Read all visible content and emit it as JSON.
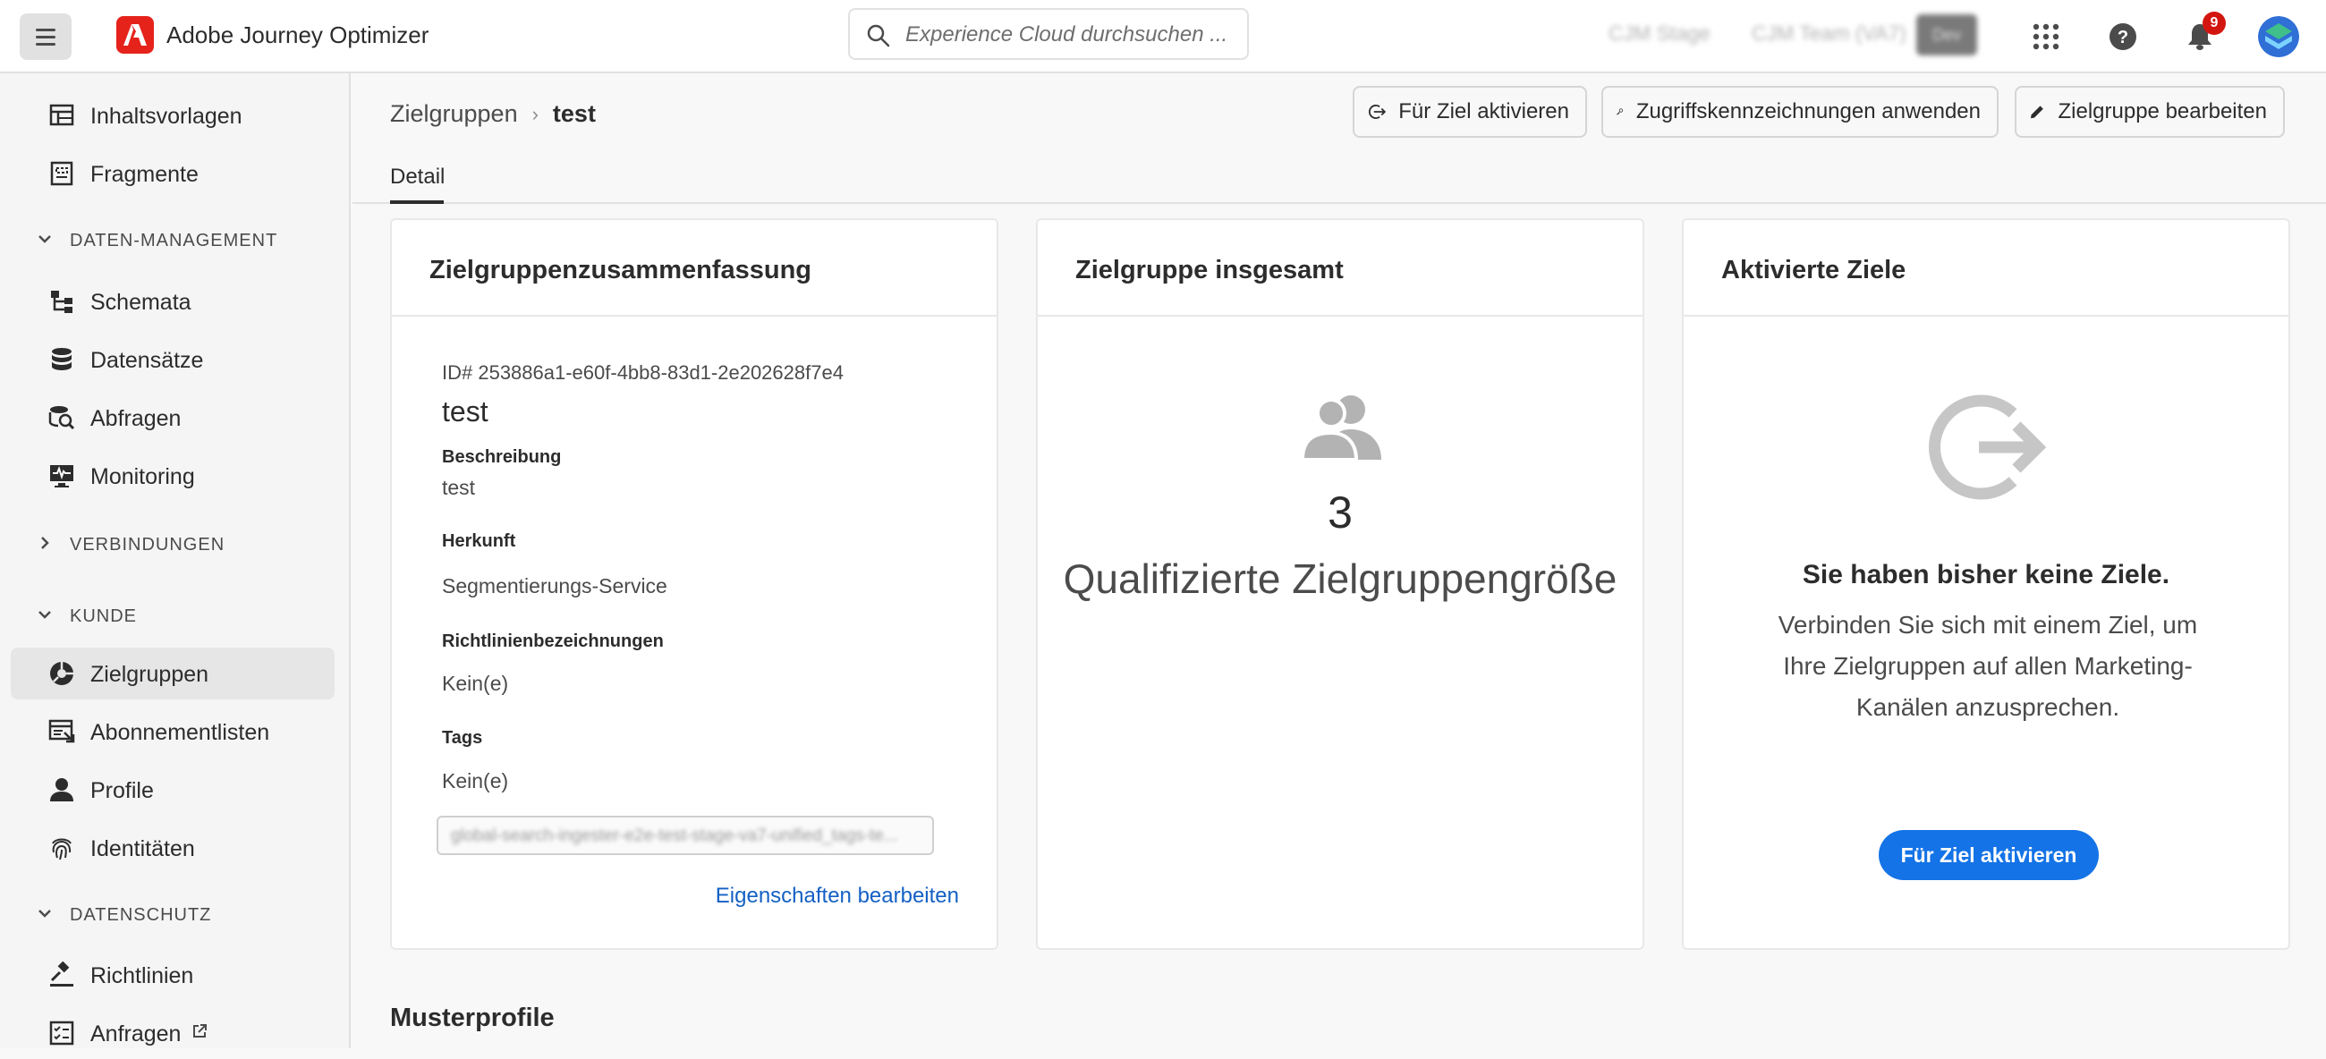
{
  "app": {
    "title": "Adobe Journey Optimizer"
  },
  "search": {
    "placeholder": "Experience Cloud durchsuchen ..."
  },
  "topbar": {
    "org1": "CJM Stage",
    "org2": "CJM Team (VA7)",
    "env_badge": "Dev",
    "notifications_count": "9"
  },
  "sidebar": {
    "items_top": [
      {
        "label": "Inhaltsvorlagen",
        "icon": "template-icon"
      },
      {
        "label": "Fragmente",
        "icon": "fragment-icon"
      }
    ],
    "sections": {
      "data_management": "DATEN-MANAGEMENT",
      "connections": "VERBINDUNGEN",
      "customer": "KUNDE",
      "privacy": "DATENSCHUTZ"
    },
    "data_items": [
      {
        "label": "Schemata"
      },
      {
        "label": "Datensätze"
      },
      {
        "label": "Abfragen"
      },
      {
        "label": "Monitoring"
      }
    ],
    "customer_items": [
      {
        "label": "Zielgruppen"
      },
      {
        "label": "Abonnementlisten"
      },
      {
        "label": "Profile"
      },
      {
        "label": "Identitäten"
      }
    ],
    "privacy_items": [
      {
        "label": "Richtlinien"
      },
      {
        "label": "Anfragen"
      }
    ]
  },
  "header": {
    "breadcrumb_parent": "Zielgruppen",
    "breadcrumb_current": "test",
    "buttons": {
      "activate": "Für Ziel aktivieren",
      "access_labels": "Zugriffskennzeichnungen anwenden",
      "edit": "Zielgruppe bearbeiten"
    },
    "tab": "Detail"
  },
  "summary_card": {
    "title": "Zielgruppenzusammenfassung",
    "id_line": "ID# 253886a1-e60f-4bb8-83d1-2e202628f7e4",
    "name": "test",
    "description_label": "Beschreibung",
    "description_value": "test",
    "origin_label": "Herkunft",
    "origin_value": "Segmentierungs-Service",
    "policy_label": "Richtlinienbezeichnungen",
    "policy_value": "Kein(e)",
    "tags_label": "Tags",
    "tags_value": "Kein(e)",
    "tag_field_text": "global-search-ingester-e2e-test-stage-va7-unified_tags-te...",
    "edit_link": "Eigenschaften bearbeiten"
  },
  "total_card": {
    "title": "Zielgruppe insgesamt",
    "count": "3",
    "count_label": "Qualifizierte Zielgruppengröße"
  },
  "destinations_card": {
    "title": "Aktivierte Ziele",
    "empty_title": "Sie haben bisher keine Ziele.",
    "empty_desc": "Verbinden Sie sich mit einem Ziel, um Ihre Zielgruppen auf allen Marketing-Kanälen anzusprechen.",
    "cta": "Für Ziel aktivieren"
  },
  "sample_profiles": {
    "title": "Musterprofile"
  }
}
